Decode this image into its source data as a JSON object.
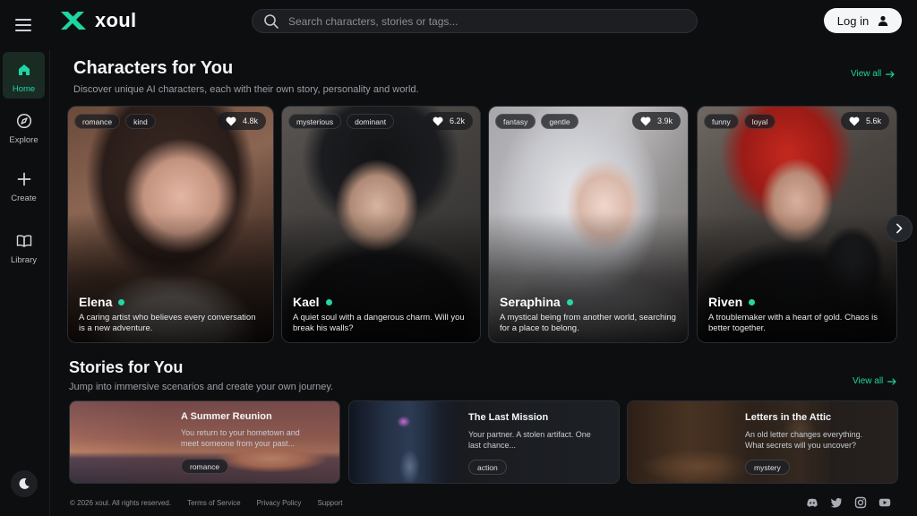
{
  "app": {
    "name": "xoul",
    "brand_color": "#1ed6a2"
  },
  "header": {
    "search_placeholder": "Search characters, stories or tags...",
    "login_label": "Log in"
  },
  "sidebar": {
    "items": [
      {
        "label": "Home",
        "icon": "home-icon",
        "active": true
      },
      {
        "label": "Explore",
        "icon": "compass-icon",
        "active": false
      },
      {
        "label": "Create",
        "icon": "plus-icon",
        "active": false
      },
      {
        "label": "Library",
        "icon": "book-icon",
        "active": false
      }
    ],
    "theme_toggle_icon": "moon-icon"
  },
  "characters": {
    "title": "Characters for You",
    "subtitle": "Discover unique AI characters, each with their own story, personality and world.",
    "view_all": "View all",
    "cards": [
      {
        "name": "Elena",
        "tags": [
          "romance",
          "kind"
        ],
        "likes": "4.8k",
        "description": "A caring artist who believes every conversation is a new adventure.",
        "online": true
      },
      {
        "name": "Kael",
        "tags": [
          "mysterious",
          "dominant"
        ],
        "likes": "6.2k",
        "description": "A quiet soul with a dangerous charm. Will you break his walls?",
        "online": true
      },
      {
        "name": "Seraphina",
        "tags": [
          "fantasy",
          "gentle"
        ],
        "likes": "3.9k",
        "description": "A mystical being from another world, searching for a place to belong.",
        "online": true
      },
      {
        "name": "Riven",
        "tags": [
          "funny",
          "loyal"
        ],
        "likes": "5.6k",
        "description": "A troublemaker with a heart of gold. Chaos is better together.",
        "online": true
      }
    ]
  },
  "stories": {
    "title": "Stories for You",
    "subtitle": "Jump into immersive scenarios and create your own journey.",
    "view_all": "View all",
    "cards": [
      {
        "title": "A Summer Reunion",
        "description": "You return to your hometown and meet someone from your past...",
        "tag": "romance"
      },
      {
        "title": "The Last Mission",
        "description": "Your partner. A stolen artifact. One last chance...",
        "tag": "action"
      },
      {
        "title": "Letters in the Attic",
        "description": "An old letter changes everything. What secrets will you uncover?",
        "tag": "mystery"
      }
    ]
  },
  "footer": {
    "copyright": "© 2026 xoul. All rights reserved.",
    "links": [
      "Terms of Service",
      "Privacy Policy",
      "Support"
    ],
    "socials": [
      "discord-icon",
      "twitter-icon",
      "instagram-icon",
      "youtube-icon"
    ]
  }
}
